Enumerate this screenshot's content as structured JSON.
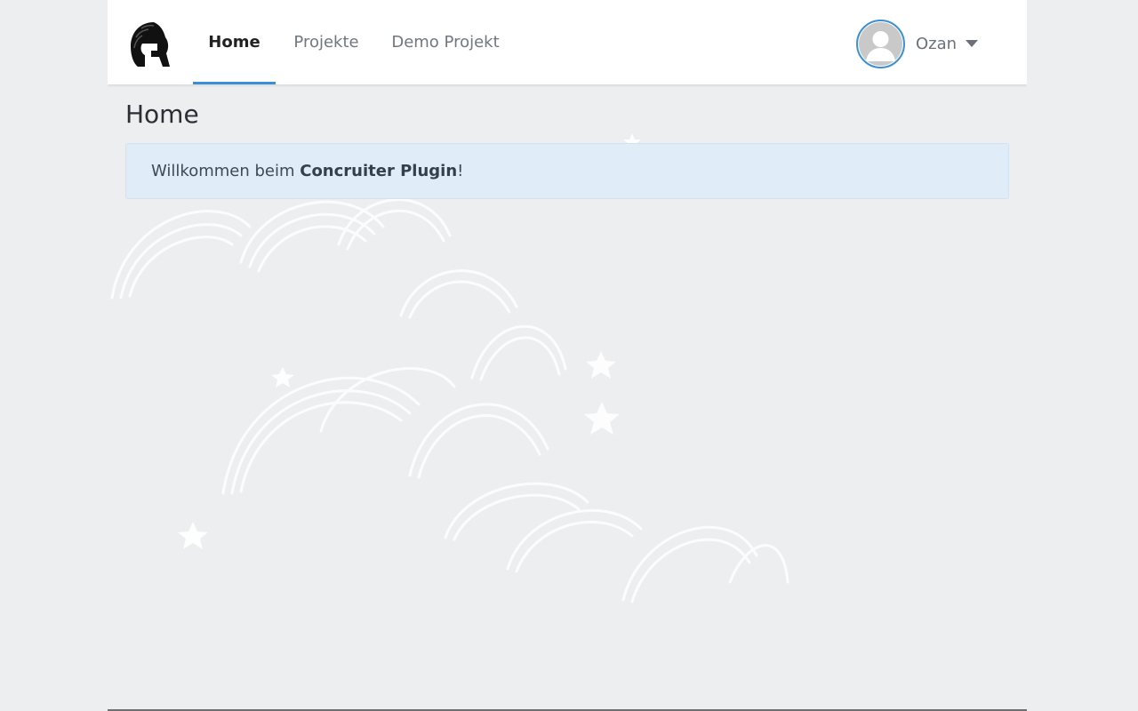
{
  "nav": {
    "items": [
      {
        "label": "Home",
        "active": true
      },
      {
        "label": "Projekte",
        "active": false
      },
      {
        "label": "Demo Projekt",
        "active": false
      }
    ],
    "accent_color": "#3b8fd4",
    "logo_icon": "spartan-helmet-icon"
  },
  "user": {
    "name": "Ozan",
    "avatar_icon": "default-user-avatar-icon"
  },
  "main": {
    "title": "Home",
    "alert": {
      "prefix": "Willkommen beim ",
      "highlight": "Concruiter Plugin",
      "suffix": "!"
    }
  }
}
